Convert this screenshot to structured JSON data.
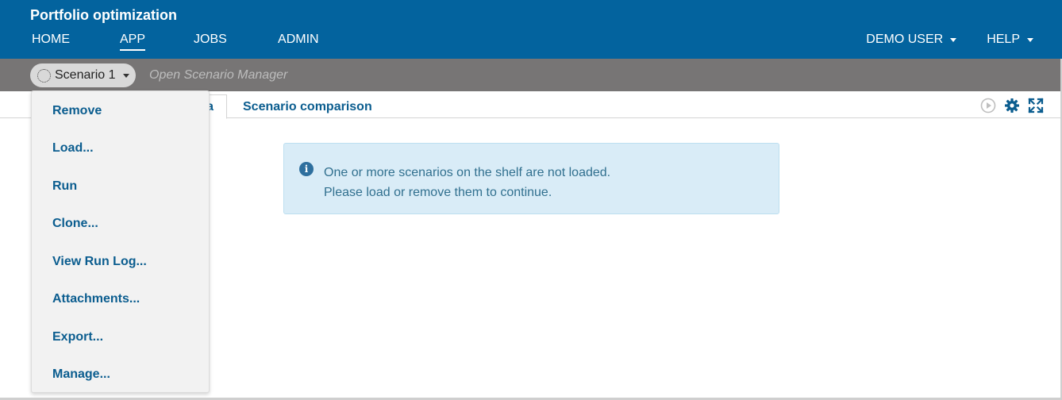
{
  "header": {
    "title": "Portfolio optimization",
    "nav": [
      "HOME",
      "APP",
      "JOBS",
      "ADMIN"
    ],
    "active_nav": "APP",
    "user_menu": "DEMO USER",
    "help_menu": "HELP",
    "background_color": "#03639e"
  },
  "shelf": {
    "scenario_name": "Scenario 1",
    "open_manager": "Open Scenario Manager",
    "background_color": "#777575"
  },
  "tabs": {
    "active_visible_text": "a",
    "comparison": "Scenario comparison"
  },
  "toolbar": {
    "icons": [
      "play-icon",
      "gear-icon",
      "expand-icon"
    ]
  },
  "info": {
    "icon": "info-icon",
    "line1": "One or more scenarios on the shelf are not loaded.",
    "line2": "Please load or remove them to continue."
  },
  "dropdown": {
    "items": [
      "Remove",
      "Load...",
      "Run",
      "Clone...",
      "View Run Log...",
      "Attachments...",
      "Export...",
      "Manage..."
    ]
  }
}
